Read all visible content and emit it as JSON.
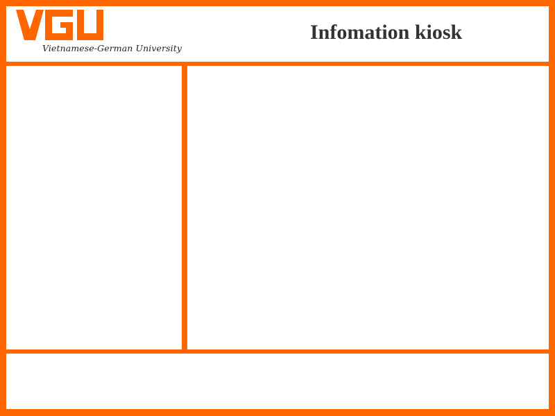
{
  "header": {
    "logo_text": "VGU",
    "tagline": "Vietnamese-German University",
    "title": "Infomation kiosk"
  },
  "colors": {
    "brand_orange": "#ff6600",
    "title_text": "#333333",
    "background": "#ffffff"
  },
  "left_panel": {},
  "main_panel": {},
  "footer": {}
}
